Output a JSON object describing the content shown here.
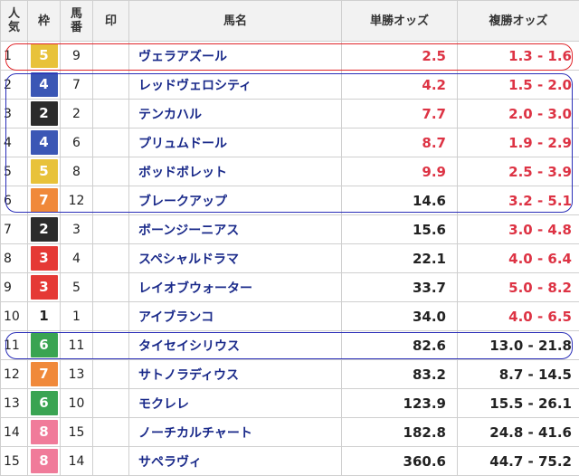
{
  "headers": {
    "popularity": "人\n気",
    "frame": "枠",
    "horse_no": "馬\n番",
    "mark": "印",
    "name": "馬名",
    "win_odds": "単勝オッズ",
    "place_odds": "複勝オッズ"
  },
  "colors": {
    "odds_red": "#dd3344",
    "odds_black": "#222222",
    "frame_1": {
      "bg": "#ffffff",
      "fg": "#222222"
    },
    "frame_2": {
      "bg": "#2b2b2b",
      "fg": "#ffffff"
    },
    "frame_3": {
      "bg": "#e53935",
      "fg": "#ffffff"
    },
    "frame_4": {
      "bg": "#3b57b5",
      "fg": "#ffffff"
    },
    "frame_5": {
      "bg": "#e8c23a",
      "fg": "#ffffff"
    },
    "frame_6": {
      "bg": "#3aa452",
      "fg": "#ffffff"
    },
    "frame_7": {
      "bg": "#f0893a",
      "fg": "#ffffff"
    },
    "frame_8": {
      "bg": "#f07b9a",
      "fg": "#ffffff"
    },
    "highlight_red": "#e0262b",
    "highlight_blue": "#2b2fb8"
  },
  "rows": [
    {
      "pop": "1",
      "frame": 5,
      "num": "9",
      "mark": "",
      "name": "ヴェラアズール",
      "win": "2.5",
      "win_red": true,
      "place": "1.3 - 1.6",
      "place_red": true
    },
    {
      "pop": "2",
      "frame": 4,
      "num": "7",
      "mark": "",
      "name": "レッドヴェロシティ",
      "win": "4.2",
      "win_red": true,
      "place": "1.5 - 2.0",
      "place_red": true
    },
    {
      "pop": "3",
      "frame": 2,
      "num": "2",
      "mark": "",
      "name": "テンカハル",
      "win": "7.7",
      "win_red": true,
      "place": "2.0 - 3.0",
      "place_red": true
    },
    {
      "pop": "4",
      "frame": 4,
      "num": "6",
      "mark": "",
      "name": "プリュムドール",
      "win": "8.7",
      "win_red": true,
      "place": "1.9 - 2.9",
      "place_red": true
    },
    {
      "pop": "5",
      "frame": 5,
      "num": "8",
      "mark": "",
      "name": "ボッドボレット",
      "win": "9.9",
      "win_red": true,
      "place": "2.5 - 3.9",
      "place_red": true
    },
    {
      "pop": "6",
      "frame": 7,
      "num": "12",
      "mark": "",
      "name": "ブレークアップ",
      "win": "14.6",
      "win_red": false,
      "place": "3.2 - 5.1",
      "place_red": true
    },
    {
      "pop": "7",
      "frame": 2,
      "num": "3",
      "mark": "",
      "name": "ボーンジーニアス",
      "win": "15.6",
      "win_red": false,
      "place": "3.0 - 4.8",
      "place_red": true
    },
    {
      "pop": "8",
      "frame": 3,
      "num": "4",
      "mark": "",
      "name": "スペシャルドラマ",
      "win": "22.1",
      "win_red": false,
      "place": "4.0 - 6.4",
      "place_red": true
    },
    {
      "pop": "9",
      "frame": 3,
      "num": "5",
      "mark": "",
      "name": "レイオブウォーター",
      "win": "33.7",
      "win_red": false,
      "place": "5.0 - 8.2",
      "place_red": true
    },
    {
      "pop": "10",
      "frame": 1,
      "num": "1",
      "mark": "",
      "name": "アイブランコ",
      "win": "34.0",
      "win_red": false,
      "place": "4.0 - 6.5",
      "place_red": true
    },
    {
      "pop": "11",
      "frame": 6,
      "num": "11",
      "mark": "",
      "name": "タイセイシリウス",
      "win": "82.6",
      "win_red": false,
      "place": "13.0 - 21.8",
      "place_red": false
    },
    {
      "pop": "12",
      "frame": 7,
      "num": "13",
      "mark": "",
      "name": "サトノラディウス",
      "win": "83.2",
      "win_red": false,
      "place": "8.7 - 14.5",
      "place_red": false
    },
    {
      "pop": "13",
      "frame": 6,
      "num": "10",
      "mark": "",
      "name": "モクレレ",
      "win": "123.9",
      "win_red": false,
      "place": "15.5 - 26.1",
      "place_red": false
    },
    {
      "pop": "14",
      "frame": 8,
      "num": "15",
      "mark": "",
      "name": "ノーチカルチャート",
      "win": "182.8",
      "win_red": false,
      "place": "24.8 - 41.6",
      "place_red": false
    },
    {
      "pop": "15",
      "frame": 8,
      "num": "14",
      "mark": "",
      "name": "サペラヴィ",
      "win": "360.6",
      "win_red": false,
      "place": "44.7 - 75.2",
      "place_red": false
    }
  ]
}
